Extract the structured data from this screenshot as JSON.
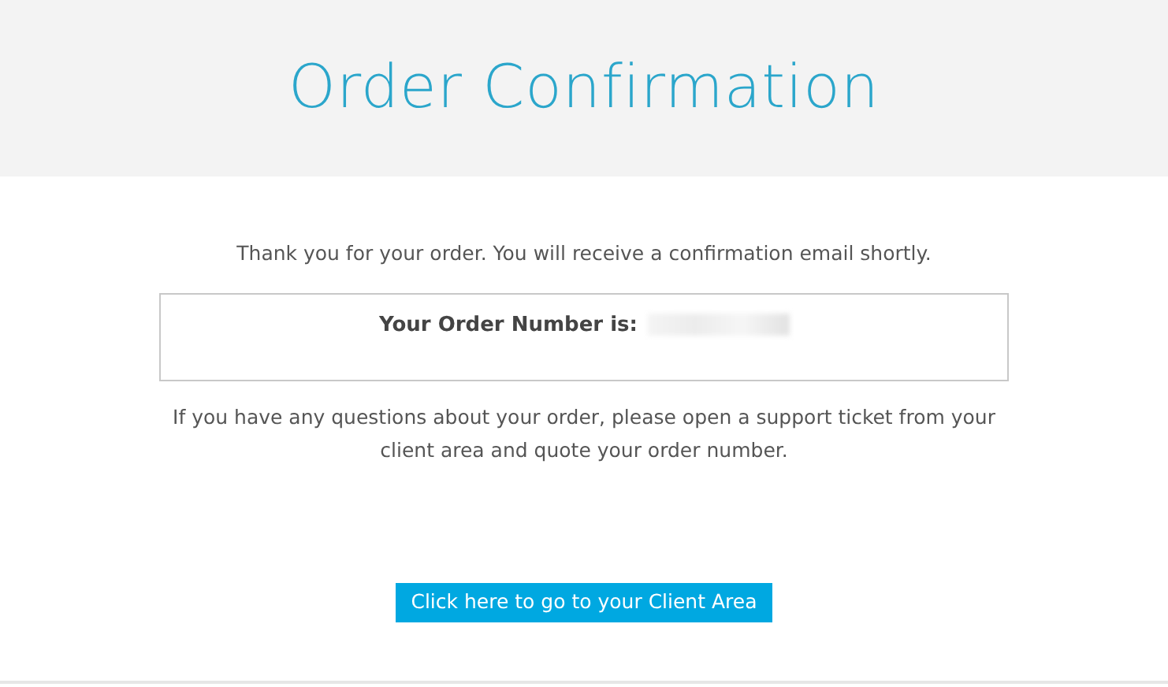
{
  "header": {
    "title": "Order Confirmation"
  },
  "thank_you": "Thank you for your order. You will receive a confirmation email shortly.",
  "order_number": {
    "label": "Your Order Number is:"
  },
  "note": "If you have any questions about your order, please open a support ticket from your client area and quote your order number.",
  "button": "Click here to go to your Client Area"
}
